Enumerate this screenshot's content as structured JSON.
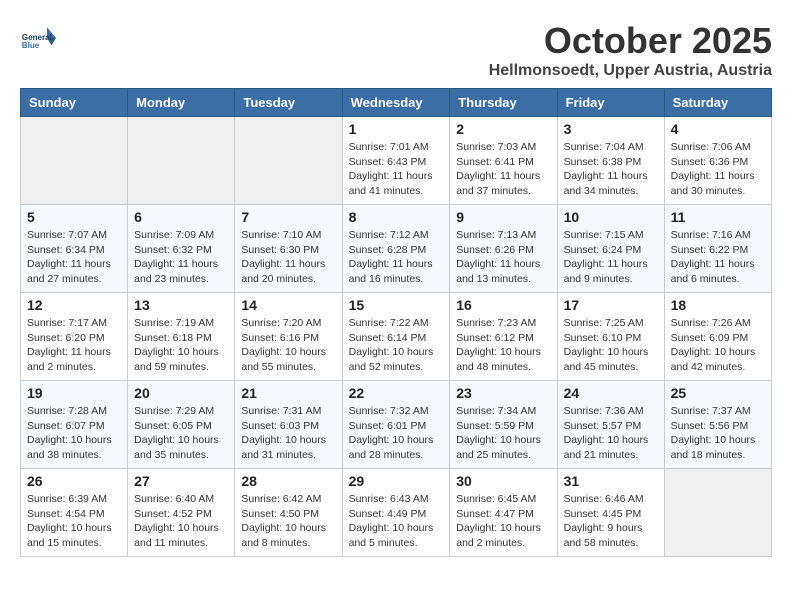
{
  "header": {
    "logo_line1": "General",
    "logo_line2": "Blue",
    "month": "October 2025",
    "location": "Hellmonsoedt, Upper Austria, Austria"
  },
  "weekdays": [
    "Sunday",
    "Monday",
    "Tuesday",
    "Wednesday",
    "Thursday",
    "Friday",
    "Saturday"
  ],
  "weeks": [
    [
      {
        "day": "",
        "info": ""
      },
      {
        "day": "",
        "info": ""
      },
      {
        "day": "",
        "info": ""
      },
      {
        "day": "1",
        "info": "Sunrise: 7:01 AM\nSunset: 6:43 PM\nDaylight: 11 hours\nand 41 minutes."
      },
      {
        "day": "2",
        "info": "Sunrise: 7:03 AM\nSunset: 6:41 PM\nDaylight: 11 hours\nand 37 minutes."
      },
      {
        "day": "3",
        "info": "Sunrise: 7:04 AM\nSunset: 6:38 PM\nDaylight: 11 hours\nand 34 minutes."
      },
      {
        "day": "4",
        "info": "Sunrise: 7:06 AM\nSunset: 6:36 PM\nDaylight: 11 hours\nand 30 minutes."
      }
    ],
    [
      {
        "day": "5",
        "info": "Sunrise: 7:07 AM\nSunset: 6:34 PM\nDaylight: 11 hours\nand 27 minutes."
      },
      {
        "day": "6",
        "info": "Sunrise: 7:09 AM\nSunset: 6:32 PM\nDaylight: 11 hours\nand 23 minutes."
      },
      {
        "day": "7",
        "info": "Sunrise: 7:10 AM\nSunset: 6:30 PM\nDaylight: 11 hours\nand 20 minutes."
      },
      {
        "day": "8",
        "info": "Sunrise: 7:12 AM\nSunset: 6:28 PM\nDaylight: 11 hours\nand 16 minutes."
      },
      {
        "day": "9",
        "info": "Sunrise: 7:13 AM\nSunset: 6:26 PM\nDaylight: 11 hours\nand 13 minutes."
      },
      {
        "day": "10",
        "info": "Sunrise: 7:15 AM\nSunset: 6:24 PM\nDaylight: 11 hours\nand 9 minutes."
      },
      {
        "day": "11",
        "info": "Sunrise: 7:16 AM\nSunset: 6:22 PM\nDaylight: 11 hours\nand 6 minutes."
      }
    ],
    [
      {
        "day": "12",
        "info": "Sunrise: 7:17 AM\nSunset: 6:20 PM\nDaylight: 11 hours\nand 2 minutes."
      },
      {
        "day": "13",
        "info": "Sunrise: 7:19 AM\nSunset: 6:18 PM\nDaylight: 10 hours\nand 59 minutes."
      },
      {
        "day": "14",
        "info": "Sunrise: 7:20 AM\nSunset: 6:16 PM\nDaylight: 10 hours\nand 55 minutes."
      },
      {
        "day": "15",
        "info": "Sunrise: 7:22 AM\nSunset: 6:14 PM\nDaylight: 10 hours\nand 52 minutes."
      },
      {
        "day": "16",
        "info": "Sunrise: 7:23 AM\nSunset: 6:12 PM\nDaylight: 10 hours\nand 48 minutes."
      },
      {
        "day": "17",
        "info": "Sunrise: 7:25 AM\nSunset: 6:10 PM\nDaylight: 10 hours\nand 45 minutes."
      },
      {
        "day": "18",
        "info": "Sunrise: 7:26 AM\nSunset: 6:09 PM\nDaylight: 10 hours\nand 42 minutes."
      }
    ],
    [
      {
        "day": "19",
        "info": "Sunrise: 7:28 AM\nSunset: 6:07 PM\nDaylight: 10 hours\nand 38 minutes."
      },
      {
        "day": "20",
        "info": "Sunrise: 7:29 AM\nSunset: 6:05 PM\nDaylight: 10 hours\nand 35 minutes."
      },
      {
        "day": "21",
        "info": "Sunrise: 7:31 AM\nSunset: 6:03 PM\nDaylight: 10 hours\nand 31 minutes."
      },
      {
        "day": "22",
        "info": "Sunrise: 7:32 AM\nSunset: 6:01 PM\nDaylight: 10 hours\nand 28 minutes."
      },
      {
        "day": "23",
        "info": "Sunrise: 7:34 AM\nSunset: 5:59 PM\nDaylight: 10 hours\nand 25 minutes."
      },
      {
        "day": "24",
        "info": "Sunrise: 7:36 AM\nSunset: 5:57 PM\nDaylight: 10 hours\nand 21 minutes."
      },
      {
        "day": "25",
        "info": "Sunrise: 7:37 AM\nSunset: 5:56 PM\nDaylight: 10 hours\nand 18 minutes."
      }
    ],
    [
      {
        "day": "26",
        "info": "Sunrise: 6:39 AM\nSunset: 4:54 PM\nDaylight: 10 hours\nand 15 minutes."
      },
      {
        "day": "27",
        "info": "Sunrise: 6:40 AM\nSunset: 4:52 PM\nDaylight: 10 hours\nand 11 minutes."
      },
      {
        "day": "28",
        "info": "Sunrise: 6:42 AM\nSunset: 4:50 PM\nDaylight: 10 hours\nand 8 minutes."
      },
      {
        "day": "29",
        "info": "Sunrise: 6:43 AM\nSunset: 4:49 PM\nDaylight: 10 hours\nand 5 minutes."
      },
      {
        "day": "30",
        "info": "Sunrise: 6:45 AM\nSunset: 4:47 PM\nDaylight: 10 hours\nand 2 minutes."
      },
      {
        "day": "31",
        "info": "Sunrise: 6:46 AM\nSunset: 4:45 PM\nDaylight: 9 hours\nand 58 minutes."
      },
      {
        "day": "",
        "info": ""
      }
    ]
  ]
}
